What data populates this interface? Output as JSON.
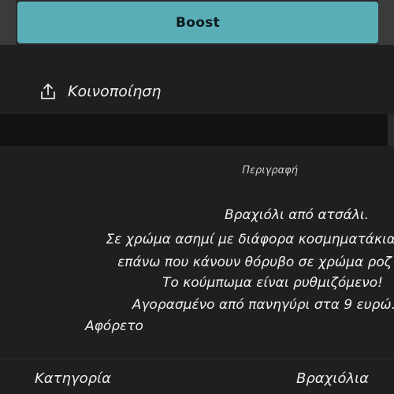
{
  "boost": {
    "label": "Boost"
  },
  "share": {
    "label": "Κοινοποίηση"
  },
  "description": {
    "heading": "Περιγραφή",
    "lines": [
      "Βραχιόλι από ατσάλι.",
      "Σε χρώμα ασημί με διάφορα κοσμηματάκια",
      "επάνω που κάνουν θόρυβο σε χρώμα ροζ",
      "Το κούμπωμα είναι ρυθμιζόμενο!",
      "Αγορασμένο από πανηγύρι στα 9 ευρώ.",
      "Αφόρετο"
    ]
  },
  "category": {
    "label": "Κατηγορία",
    "value": "Βραχιόλια"
  },
  "colors": {
    "accent": "#5aaeb8",
    "background": "#1f1f1f",
    "divider": "#111111"
  },
  "icons": {
    "share": "share-icon"
  }
}
